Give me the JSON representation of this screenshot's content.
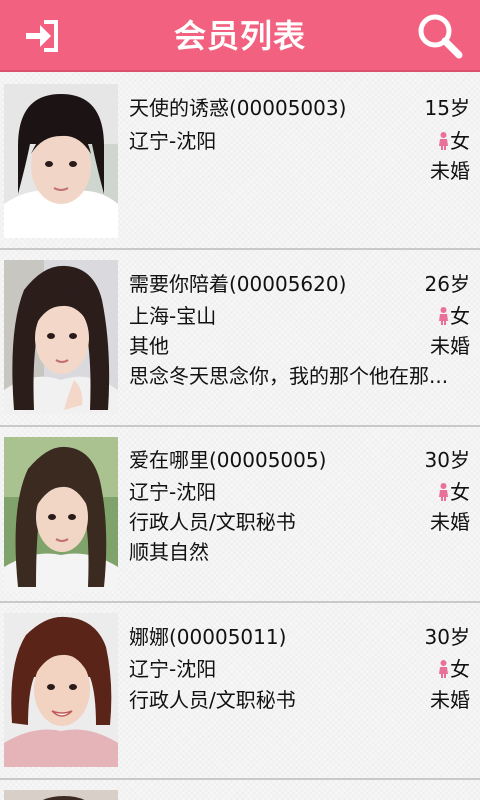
{
  "header": {
    "title": "会员列表",
    "login_icon": "login-arrow-icon",
    "search_icon": "search-icon"
  },
  "colors": {
    "accent": "#f2617f",
    "gender_female": "#e8709a"
  },
  "members": [
    {
      "name": "天使的诱惑(00005003)",
      "age": "15岁",
      "location": "辽宁-沈阳",
      "gender": "女",
      "job": "",
      "marital": "未婚",
      "signature": ""
    },
    {
      "name": "需要你陪着(00005620)",
      "age": "26岁",
      "location": "上海-宝山",
      "gender": "女",
      "job": "其他",
      "marital": "未婚",
      "signature": "思念冬天思念你，我的那个他在那..."
    },
    {
      "name": "爱在哪里(00005005)",
      "age": "30岁",
      "location": "辽宁-沈阳",
      "gender": "女",
      "job": "行政人员/文职秘书",
      "marital": "未婚",
      "signature": "顺其自然"
    },
    {
      "name": "娜娜(00005011)",
      "age": "30岁",
      "location": "辽宁-沈阳",
      "gender": "女",
      "job": "行政人员/文职秘书",
      "marital": "未婚",
      "signature": ""
    }
  ]
}
